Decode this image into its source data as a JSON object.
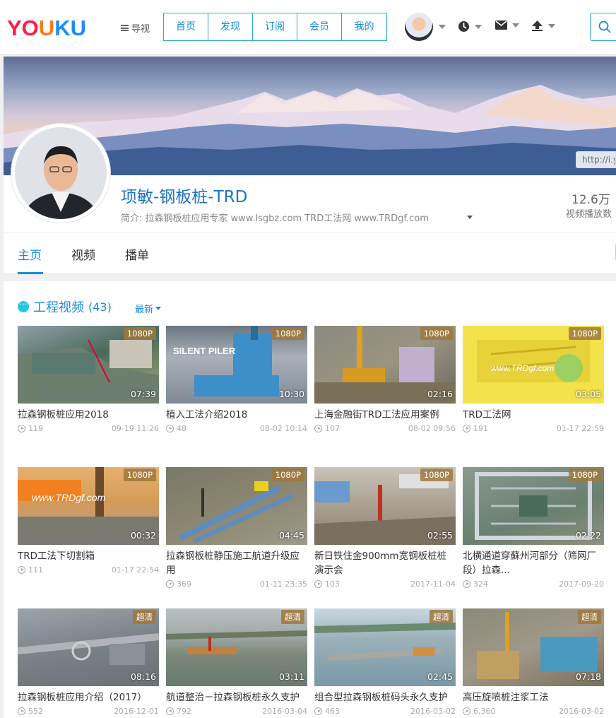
{
  "header": {
    "logo": {
      "a": "YO",
      "b": "U",
      "c": "KU"
    },
    "guide_label": "导视",
    "nav": [
      "首页",
      "发现",
      "订阅",
      "会员",
      "我的"
    ],
    "icons": [
      "history-icon",
      "message-icon",
      "upload-icon",
      "search-icon"
    ]
  },
  "banner": {
    "url_text": "http://i.y"
  },
  "profile": {
    "name": "项敏-钢板桩-TRD",
    "intro": "简介: 拉森钢板桩应用专家 www.lsgbz.com TRD工法网 www.TRDgf.com",
    "stat_value": "12.6万",
    "stat_label": "视频播放数"
  },
  "tabs": [
    "主页",
    "视频",
    "播单"
  ],
  "section": {
    "title": "工程视频",
    "count": "(43)",
    "sort_label": "最新"
  },
  "colors": {
    "accent": "#1a8cd8",
    "logo_red": "#ff1c48",
    "logo_orange": "#ff7c1f",
    "logo_blue": "#1a8cff"
  },
  "videos": [
    {
      "title": "拉森钢板桩应用2018",
      "badge": "1080P",
      "duration": "07:39",
      "plays": "119",
      "date": "09-19 11:26"
    },
    {
      "title": "植入工法介绍2018",
      "badge": "1080P",
      "duration": "10:30",
      "plays": "48",
      "date": "08-02 10:14"
    },
    {
      "title": "上海金融街TRD工法应用案例",
      "badge": "1080P",
      "duration": "02:16",
      "plays": "107",
      "date": "08-02 09:56"
    },
    {
      "title": "TRD工法网",
      "badge": "1080P",
      "duration": "03:05",
      "plays": "191",
      "date": "01-17 22:59"
    },
    {
      "title": "TRD工法下切割箱",
      "badge": "1080P",
      "duration": "00:32",
      "plays": "111",
      "date": "01-17 22:54"
    },
    {
      "title": "拉森钢板桩静压施工航道升级应用",
      "badge": "1080P",
      "duration": "04:45",
      "plays": "369",
      "date": "01-11 23:35"
    },
    {
      "title": "新日铁住金900mm宽钢板桩桩演示会",
      "badge": "1080P",
      "duration": "02:55",
      "plays": "103",
      "date": "2017-11-04"
    },
    {
      "title": "北横通道穿蘇州河部分（筛网厂段）拉森...",
      "badge": "1080P",
      "duration": "02:22",
      "plays": "324",
      "date": "2017-09-20"
    },
    {
      "title": "拉森钢板桩应用介绍（2017）",
      "badge": "超清",
      "duration": "08:16",
      "plays": "552",
      "date": "2016-12-01"
    },
    {
      "title": "航道整治－拉森钢板桩永久支护",
      "badge": "超清",
      "duration": "03:11",
      "plays": "792",
      "date": "2016-03-04"
    },
    {
      "title": "组合型拉森钢板桩码头永久支护",
      "badge": "超清",
      "duration": "02:45",
      "plays": "463",
      "date": "2016-03-02"
    },
    {
      "title": "高压旋喷桩注浆工法",
      "badge": "超清",
      "duration": "07:18",
      "plays": "6,360",
      "date": "2016-03-02"
    }
  ]
}
